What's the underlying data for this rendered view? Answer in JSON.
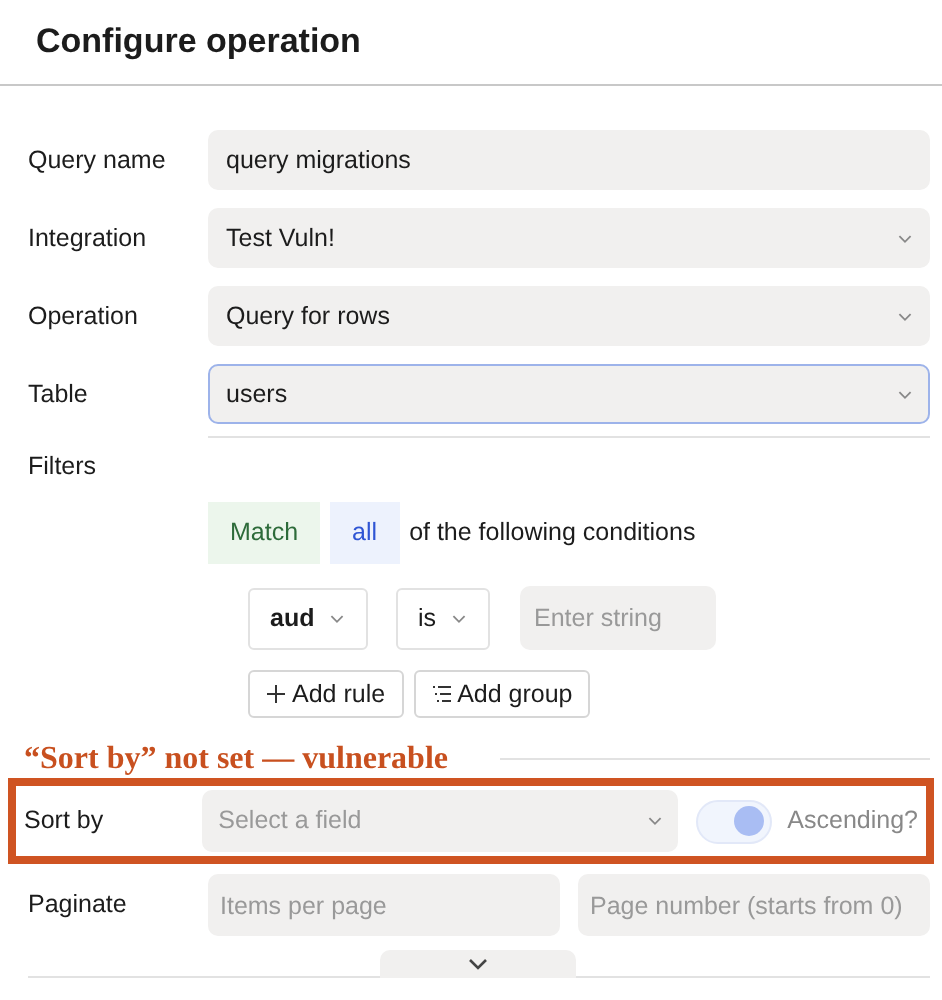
{
  "title": "Configure operation",
  "fields": [
    {
      "label": "Query name",
      "kind": "text",
      "value": "query migrations",
      "focused": false
    },
    {
      "label": "Integration",
      "kind": "select",
      "value": "Test Vuln!",
      "focused": false
    },
    {
      "label": "Operation",
      "kind": "select",
      "value": "Query for rows",
      "focused": false
    },
    {
      "label": "Table",
      "kind": "select",
      "value": "users",
      "focused": true
    }
  ],
  "filters": {
    "label": "Filters",
    "match": "Match",
    "quantifier": "all",
    "suffix": "of the following conditions",
    "rule": {
      "field": "aud",
      "operator": "is",
      "placeholder": "Enter string"
    },
    "buttons": [
      {
        "label": "Add rule",
        "kind": "plus"
      },
      {
        "label": "Add group",
        "kind": "list"
      }
    ]
  },
  "annotation": "“Sort by” not set — vulnerable",
  "sort": {
    "label": "Sort by",
    "placeholder": "Select a field",
    "toggle_on": true,
    "toggle_label": "Ascending?"
  },
  "paginate": {
    "label": "Paginate",
    "placeholders": [
      "Items per page",
      "Page number (starts from 0)"
    ]
  }
}
